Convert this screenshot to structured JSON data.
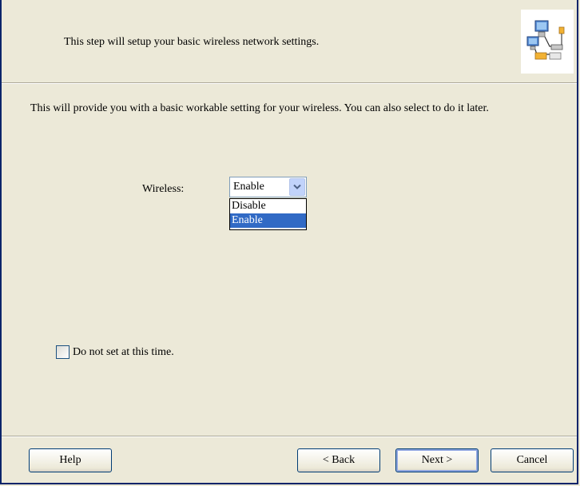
{
  "header": {
    "text": "This step will setup your basic wireless network settings.",
    "icon": "network-computers-icon"
  },
  "description": "This will provide you with a basic workable setting for your wireless. You can also select to do it later.",
  "wireless": {
    "label": "Wireless:",
    "selected_value": "Enable",
    "options": [
      "Disable",
      "Enable"
    ],
    "highlighted_option": "Enable"
  },
  "skip_checkbox": {
    "label": "Do not set at this time.",
    "checked": false
  },
  "buttons": {
    "help": "Help",
    "back": "< Back",
    "next": "Next >",
    "cancel": "Cancel"
  },
  "colors": {
    "dialog_bg": "#ece9d8",
    "selection": "#316ac5",
    "frame": "#0a246a"
  }
}
